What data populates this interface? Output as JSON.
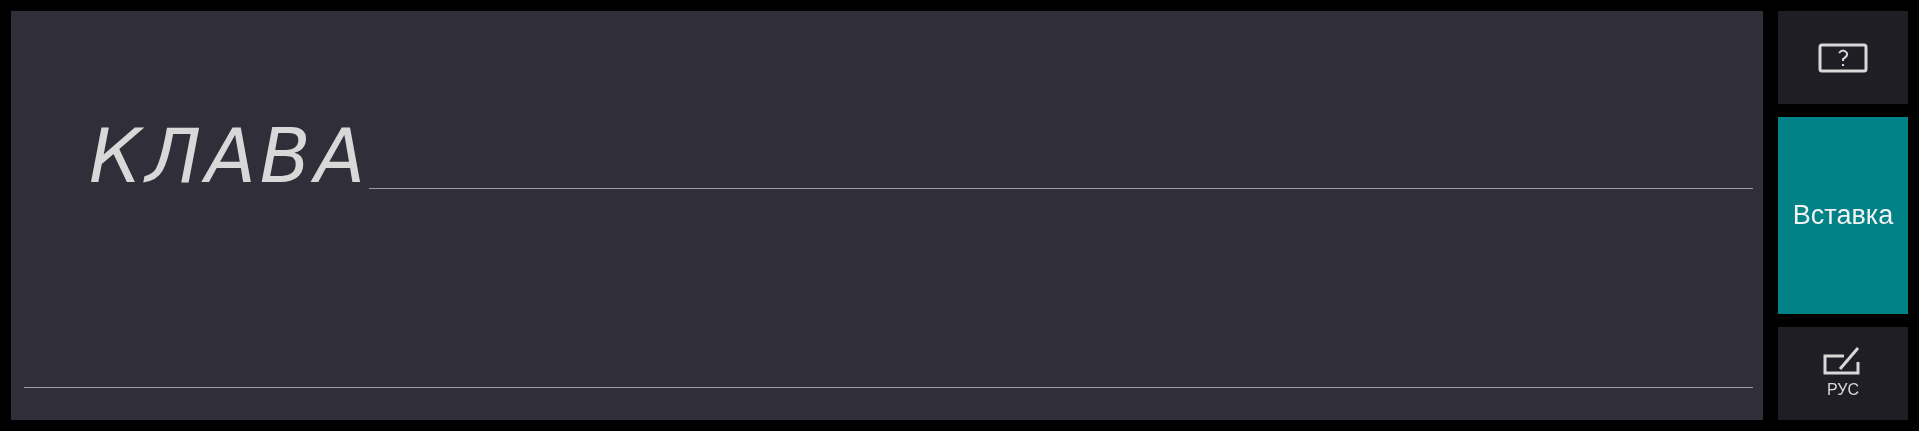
{
  "writing_area": {
    "ink_text": "КЛАВА"
  },
  "side_buttons": [
    {
      "kind": "help"
    },
    {
      "kind": "insert",
      "label": "Вставка"
    },
    {
      "kind": "mode",
      "label": "РУС"
    }
  ]
}
